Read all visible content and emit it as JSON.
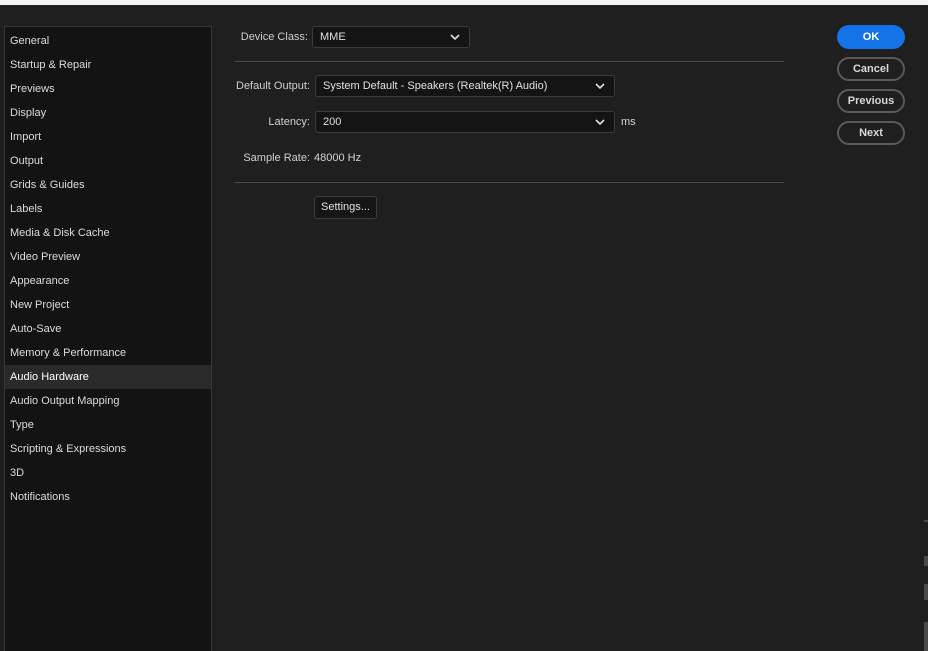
{
  "sidebar": {
    "items": [
      {
        "label": "General"
      },
      {
        "label": "Startup & Repair"
      },
      {
        "label": "Previews"
      },
      {
        "label": "Display"
      },
      {
        "label": "Import"
      },
      {
        "label": "Output"
      },
      {
        "label": "Grids & Guides"
      },
      {
        "label": "Labels"
      },
      {
        "label": "Media & Disk Cache"
      },
      {
        "label": "Video Preview"
      },
      {
        "label": "Appearance"
      },
      {
        "label": "New Project"
      },
      {
        "label": "Auto-Save"
      },
      {
        "label": "Memory & Performance"
      },
      {
        "label": "Audio Hardware"
      },
      {
        "label": "Audio Output Mapping"
      },
      {
        "label": "Type"
      },
      {
        "label": "Scripting & Expressions"
      },
      {
        "label": "3D"
      },
      {
        "label": "Notifications"
      }
    ],
    "selected": "Audio Hardware"
  },
  "form": {
    "device_class_label": "Device Class:",
    "device_class_value": "MME",
    "default_output_label": "Default Output:",
    "default_output_value": "System Default - Speakers (Realtek(R) Audio)",
    "latency_label": "Latency:",
    "latency_value": "200",
    "latency_unit": "ms",
    "sample_rate_label": "Sample Rate:",
    "sample_rate_value": "48000 Hz",
    "settings_button": "Settings..."
  },
  "actions": {
    "ok": "OK",
    "cancel": "Cancel",
    "previous": "Previous",
    "next": "Next"
  },
  "colors": {
    "accent": "#1473e6",
    "background": "#1f1f1f",
    "sidebar_bg": "#131313"
  },
  "icons": {
    "dropdown": "chevron-down-icon"
  }
}
